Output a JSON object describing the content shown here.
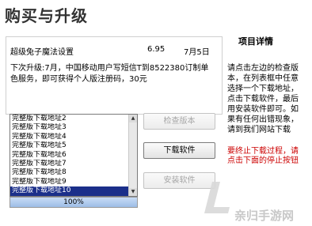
{
  "window": {
    "title": "购买与升级"
  },
  "product": {
    "name": "超级兔子魔法设置",
    "version": "6.95",
    "date": "7月5日",
    "notice": "下次升级:7月，中国移动用户写短信T到8522380订制单色服务，即可获得个人版注册码，30元"
  },
  "download_list": {
    "items": [
      "完整版下载地址2",
      "完整版下载地址3",
      "完整版下载地址4",
      "完整版下载地址5",
      "完整版下载地址6",
      "完整版下载地址7",
      "完整版下载地址8",
      "完整版下载地址9",
      "完整版下载地址10"
    ],
    "selected_index": 8
  },
  "progress": {
    "value": 1.0,
    "label": "100%"
  },
  "buttons": {
    "check_version": "检查版本",
    "download": "下载软件",
    "install": "安装软件"
  },
  "sidebar": {
    "title": "项目详情",
    "help": "请点击左边的检查版本，在列表框中任意选择一个下载地址，点击下载软件，最后用安装软件即可。如果有任何出错现象，请到我们网站下载",
    "warning": "要终止下载过程，请点击下面的停止按钮"
  },
  "watermark": {
    "text": "亲归手游网",
    "icon": "watermark-logo-icon"
  }
}
